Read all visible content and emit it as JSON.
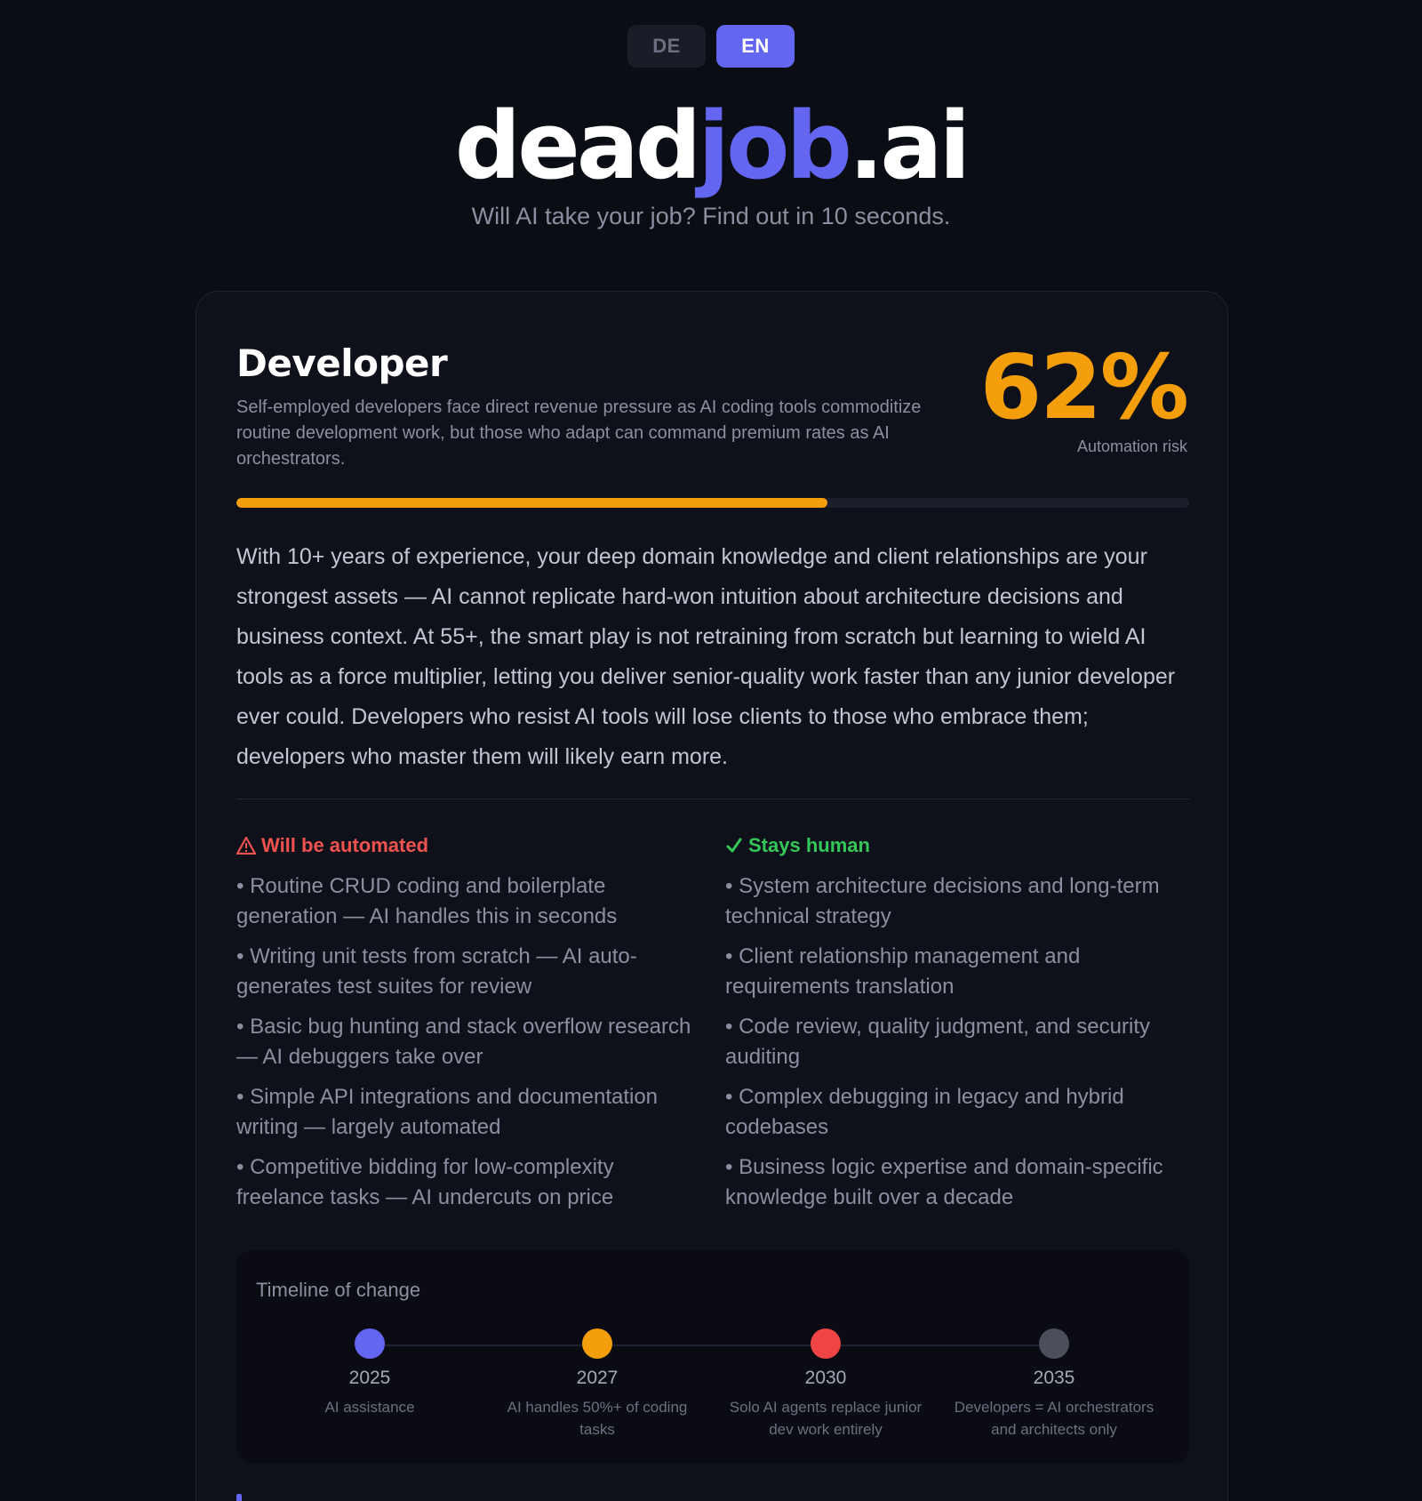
{
  "lang": {
    "de": "DE",
    "en": "EN",
    "active": "EN"
  },
  "logo": {
    "part1": "dead",
    "part2": "job",
    "part3": ".ai"
  },
  "tagline": "Will AI take your job? Find out in 10 seconds.",
  "result": {
    "job_title": "Developer",
    "summary": "Self-employed developers face direct revenue pressure as AI coding tools commoditize routine development work, but those who adapt can command premium rates as AI orchestrators.",
    "risk_value": "62%",
    "risk_percent": 62,
    "risk_label": "Automation risk",
    "advice": "With 10+ years of experience, your deep domain knowledge and client relationships are your strongest assets — AI cannot replicate hard-won intuition about architecture decisions and business context. At 55+, the smart play is not retraining from scratch but learning to wield AI tools as a force multiplier, letting you deliver senior-quality work faster than any junior developer ever could. Developers who resist AI tools will lose clients to those who embrace them; developers who master them will likely earn more."
  },
  "automated": {
    "title": "Will be automated",
    "items": [
      "• Routine CRUD coding and boilerplate generation — AI handles this in seconds",
      "• Writing unit tests from scratch — AI auto-generates test suites for review",
      "• Basic bug hunting and stack overflow research — AI debuggers take over",
      "• Simple API integrations and documentation writing — largely automated",
      "• Competitive bidding for low-complexity freelance tasks — AI undercuts on price"
    ]
  },
  "human": {
    "title": "Stays human",
    "items": [
      "• System architecture decisions and long-term technical strategy",
      "• Client relationship management and requirements translation",
      "• Code review, quality judgment, and security auditing",
      "• Complex debugging in legacy and hybrid codebases",
      "• Business logic expertise and domain-specific knowledge built over a decade"
    ]
  },
  "timeline": {
    "title": "Timeline of change",
    "items": [
      {
        "year": "2025",
        "desc": "AI assistance",
        "color": "#6366f1"
      },
      {
        "year": "2027",
        "desc": "AI handles 50%+ of coding tasks",
        "color": "#f59e0b"
      },
      {
        "year": "2030",
        "desc": "Solo AI agents replace junior dev work entirely",
        "color": "#ef4444"
      },
      {
        "year": "2035",
        "desc": "Developers = AI orchestrators and architects only",
        "color": "#4b4f5c"
      }
    ]
  },
  "colors": {
    "accent": "#6366f1",
    "risk": "#f59e0b",
    "bad": "#ef5350",
    "good": "#34c759"
  }
}
